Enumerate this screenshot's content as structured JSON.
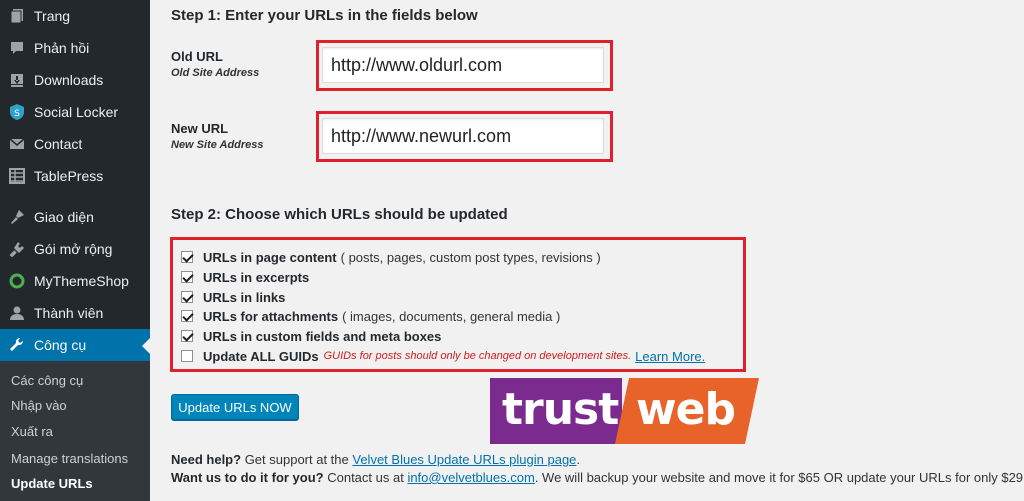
{
  "sidebar": {
    "items": [
      {
        "label": "Trang",
        "icon": "pages-icon"
      },
      {
        "label": "Phản hồi",
        "icon": "comments-icon"
      },
      {
        "label": "Downloads",
        "icon": "download-icon"
      },
      {
        "label": "Social Locker",
        "icon": "shield-icon"
      },
      {
        "label": "Contact",
        "icon": "mail-icon"
      },
      {
        "label": "TablePress",
        "icon": "table-icon"
      },
      {
        "label": "Giao diện",
        "icon": "appearance-icon"
      },
      {
        "label": "Gói mở rộng",
        "icon": "plugins-icon"
      },
      {
        "label": "MyThemeShop",
        "icon": "mythemeshop-icon"
      },
      {
        "label": "Thành viên",
        "icon": "users-icon"
      },
      {
        "label": "Công cụ",
        "icon": "wrench-icon"
      }
    ],
    "submenu": [
      "Các công cụ",
      "Nhập vào",
      "Xuất ra",
      "Manage translations",
      "Update URLs"
    ]
  },
  "step1": {
    "heading": "Step 1: Enter your URLs in the fields below",
    "old_url_label": "Old URL",
    "old_url_sub": "Old Site Address",
    "old_url_value": "http://www.oldurl.com",
    "new_url_label": "New URL",
    "new_url_sub": "New Site Address",
    "new_url_value": "http://www.newurl.com"
  },
  "step2": {
    "heading": "Step 2: Choose which URLs should be updated",
    "options": [
      {
        "label": "URLs in page content",
        "desc": "( posts, pages, custom post types, revisions )",
        "checked": true
      },
      {
        "label": "URLs in excerpts",
        "desc": "",
        "checked": true
      },
      {
        "label": "URLs in links",
        "desc": "",
        "checked": true
      },
      {
        "label": "URLs for attachments",
        "desc": "( images, documents, general media )",
        "checked": true
      },
      {
        "label": "URLs in custom fields and meta boxes",
        "desc": "",
        "checked": true
      }
    ],
    "guid_label": "Update ALL GUIDs",
    "guid_checked": false,
    "guid_warning": "GUIDs for posts should only be changed on development sites.",
    "learn_more": "Learn More."
  },
  "update_button": "Update URLs NOW",
  "logo": {
    "left": "trust",
    "right": "web"
  },
  "footer": {
    "help_strong": "Need help?",
    "help_text": " Get support at the ",
    "help_link": "Velvet Blues Update URLs plugin page",
    "help_end": ".",
    "hire_strong": "Want us to do it for you?",
    "hire_text1": " Contact us at ",
    "hire_link": "info@velvetblues.com",
    "hire_text2": ". We will backup your website and move it for $65 OR update your URLs for only $29."
  },
  "colors": {
    "sidebar_bg": "#23282d",
    "active": "#0073aa",
    "highlight_border": "#e0202a",
    "button": "#0085ba",
    "logo_purple": "#7b2b8e",
    "logo_orange": "#e8632a"
  }
}
